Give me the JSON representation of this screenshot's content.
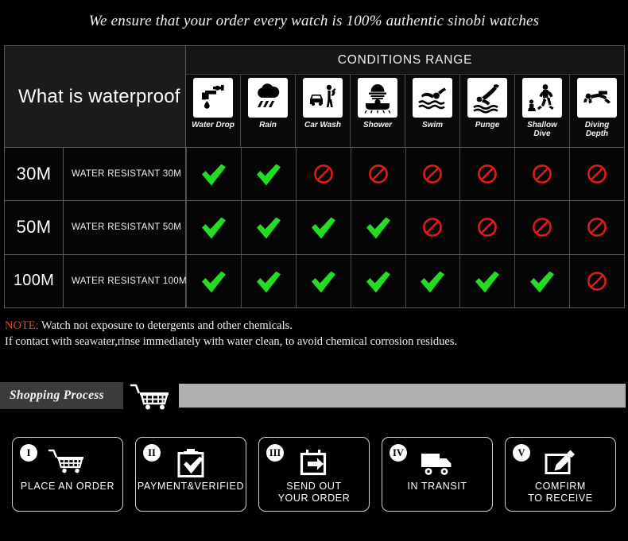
{
  "headline": "We ensure that your order every watch is 100% authentic sinobi watches",
  "table": {
    "title": "What is waterproof",
    "conditions_title": "CONDITIONS RANGE",
    "conditions": [
      {
        "label": "Water Drop",
        "icon": "faucet-drip-icon"
      },
      {
        "label": "Rain",
        "icon": "rain-cloud-icon"
      },
      {
        "label": "Car Wash",
        "icon": "car-wash-icon"
      },
      {
        "label": "Shower",
        "icon": "shower-icon"
      },
      {
        "label": "Swim",
        "icon": "swimmer-icon"
      },
      {
        "label": "Punge",
        "icon": "plunge-dive-icon"
      },
      {
        "label": "Shallow\nDive",
        "icon": "shallow-dive-icon"
      },
      {
        "label": "Diving\nDepth",
        "icon": "scuba-diver-icon"
      }
    ],
    "rows": [
      {
        "depth": "30M",
        "description": "WATER RESISTANT  30M",
        "marks": [
          "yes",
          "yes",
          "no",
          "no",
          "no",
          "no",
          "no",
          "no"
        ]
      },
      {
        "depth": "50M",
        "description": "WATER RESISTANT 50M",
        "marks": [
          "yes",
          "yes",
          "yes",
          "yes",
          "no",
          "no",
          "no",
          "no"
        ]
      },
      {
        "depth": "100M",
        "description": "WATER RESISTANT  100M",
        "marks": [
          "yes",
          "yes",
          "yes",
          "yes",
          "yes",
          "yes",
          "yes",
          "no"
        ]
      }
    ],
    "mark_yes_color": "#22dd22",
    "mark_no_color": "#e01b1b"
  },
  "note": {
    "label": "NOTE:",
    "line1": " Watch not exposure to detergents and other chemicals.",
    "line2": "If contact with seawater,rinse immediately with water clean, to avoid chemical corrosion residues.",
    "label_color": "#d1501f"
  },
  "shopping_process": {
    "tag": "Shopping Process",
    "cart_icon": "shopping-cart-icon",
    "bar_color": "#b0b0b0"
  },
  "steps": [
    {
      "numeral": "I",
      "label": "PLACE AN ORDER",
      "icon": "shopping-cart-icon"
    },
    {
      "numeral": "II",
      "label": "PAYMENT&VERIFIED",
      "icon": "clipboard-check-icon"
    },
    {
      "numeral": "III",
      "label": "SEND OUT\nYOUR ORDER",
      "icon": "package-out-icon"
    },
    {
      "numeral": "IV",
      "label": "IN TRANSIT",
      "icon": "delivery-truck-icon"
    },
    {
      "numeral": "V",
      "label": "COMFIRM\nTO RECEIVE",
      "icon": "sign-document-icon"
    }
  ]
}
